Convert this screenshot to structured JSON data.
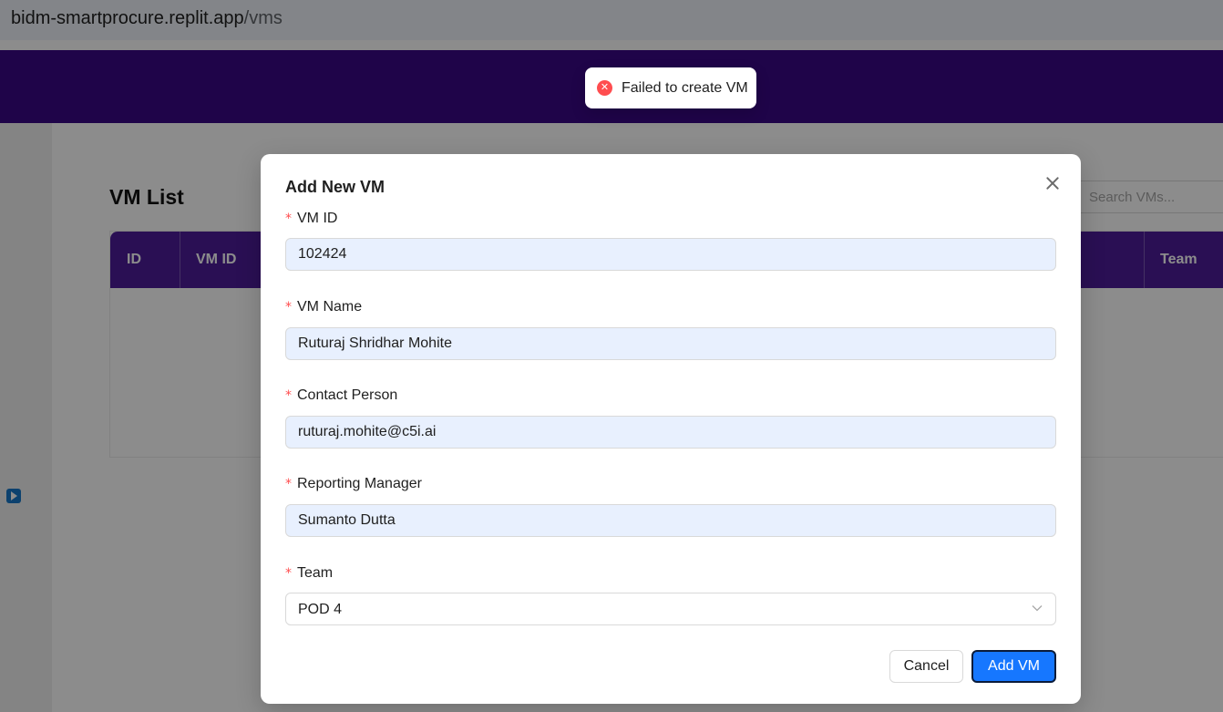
{
  "browser": {
    "url_host": "bidm-smartprocure.replit.app",
    "url_path": "/vms"
  },
  "page": {
    "title": "VM List",
    "search_placeholder": "Search VMs...",
    "table_headers": [
      "ID",
      "VM ID",
      "Team"
    ]
  },
  "toast": {
    "type": "error",
    "icon": "error-circle-icon",
    "message": "Failed to create VM",
    "color": "#ff4d4f"
  },
  "modal": {
    "title": "Add New VM",
    "fields": [
      {
        "label": "VM ID",
        "value": "102424",
        "required": true
      },
      {
        "label": "VM Name",
        "value": "Ruturaj Shridhar Mohite",
        "required": true
      },
      {
        "label": "Contact Person",
        "value": "ruturaj.mohite@c5i.ai",
        "required": true
      },
      {
        "label": "Reporting Manager",
        "value": "Sumanto Dutta",
        "required": true
      },
      {
        "label": "Team",
        "value": "POD 4",
        "required": true,
        "type": "select"
      }
    ],
    "cancel_label": "Cancel",
    "submit_label": "Add VM"
  },
  "colors": {
    "header": "#3a0986",
    "table_header": "#4d1d99",
    "primary": "#1677ff",
    "required": "#ff4d4f",
    "input_autofill": "#e8f0fe"
  }
}
